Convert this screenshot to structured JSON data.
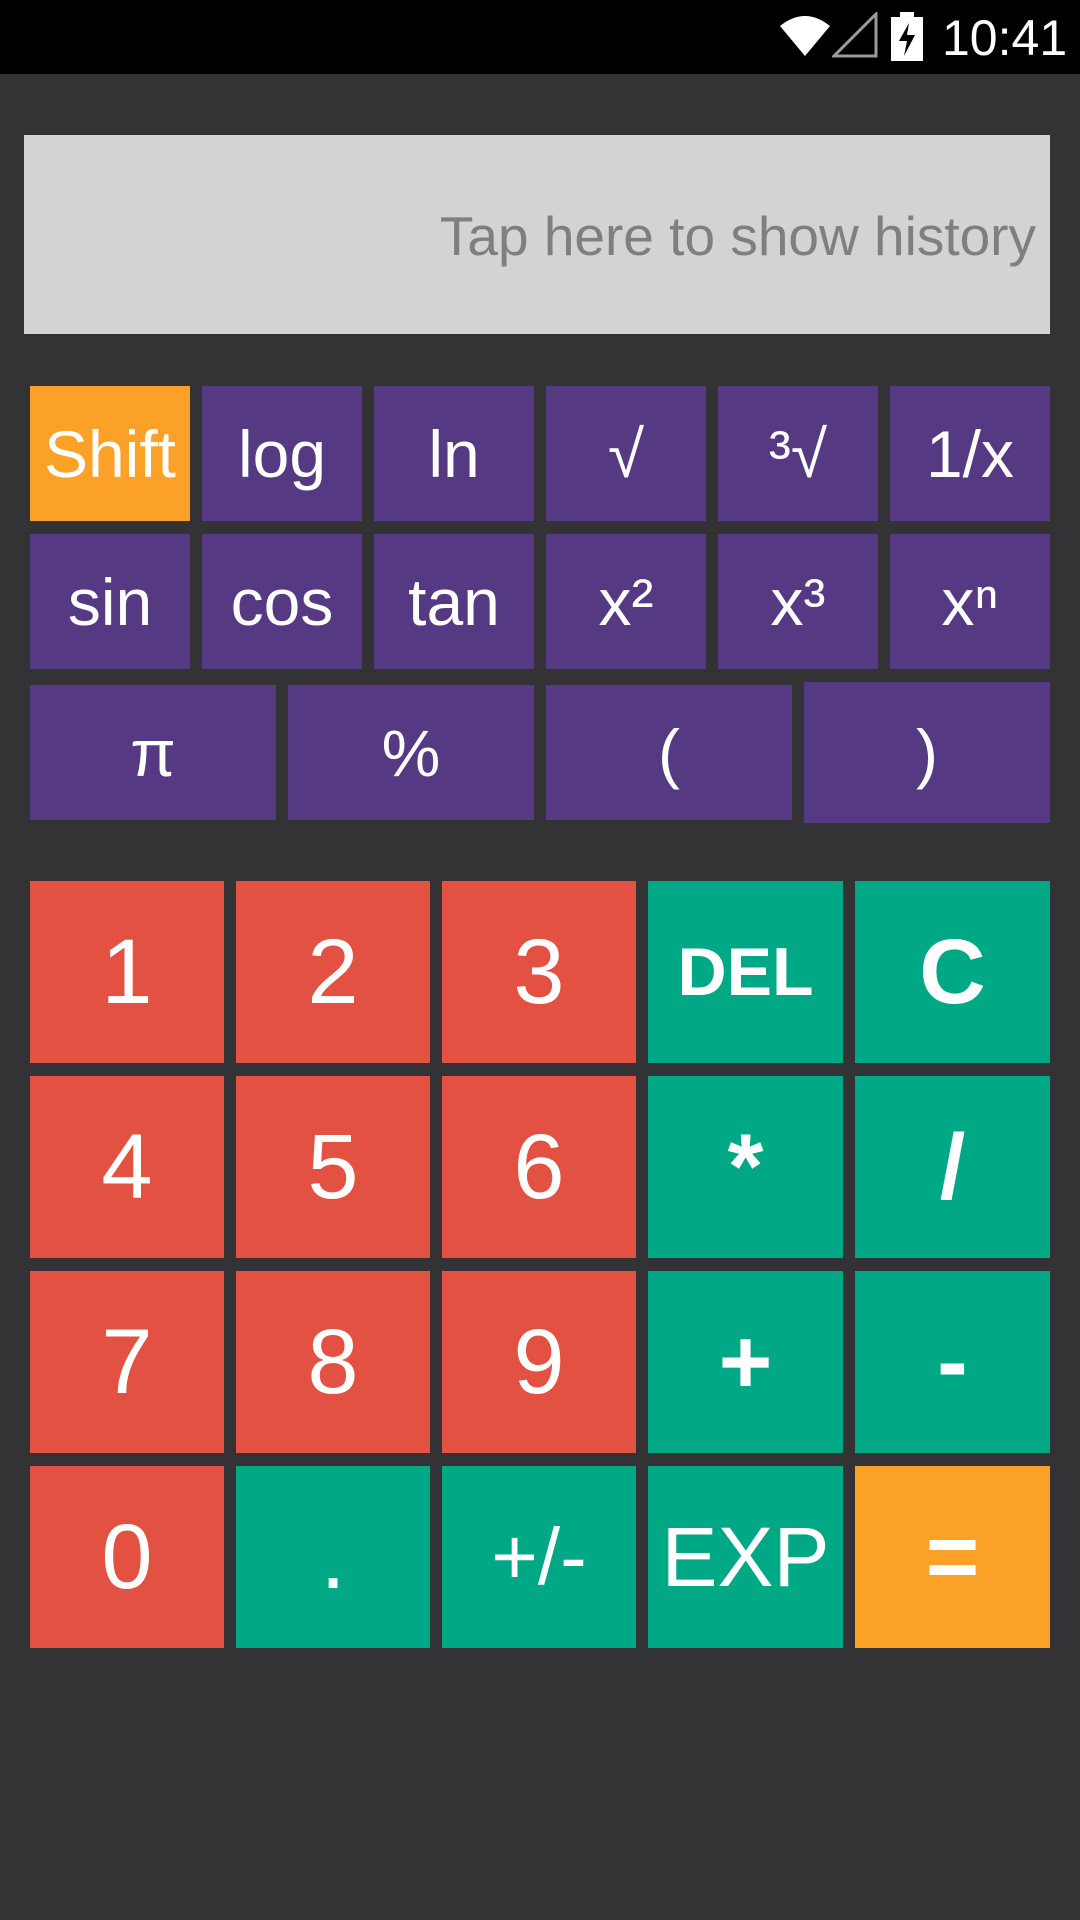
{
  "status_bar": {
    "time": "10:41",
    "icons": [
      "wifi-icon",
      "signal-icon",
      "battery-charging-icon"
    ]
  },
  "display": {
    "hint": "Tap here to show history"
  },
  "scientific_keys": {
    "row1": [
      "Shift",
      "log",
      "ln",
      "√",
      "³√",
      "1/x"
    ],
    "row2": [
      "sin",
      "cos",
      "tan",
      "x²",
      "x³",
      "xⁿ"
    ],
    "row3": [
      "π",
      "%",
      "(",
      ")"
    ]
  },
  "keypad": {
    "row1": [
      "1",
      "2",
      "3",
      "DEL",
      "C"
    ],
    "row2": [
      "4",
      "5",
      "6",
      "*",
      "/"
    ],
    "row3": [
      "7",
      "8",
      "9",
      "+",
      "-"
    ],
    "row4": [
      "0",
      ".",
      "+/-",
      "EXP",
      "="
    ]
  },
  "colors": {
    "background": "#333335",
    "display": "#d1d3d4",
    "purple": "#553982",
    "orange": "#fba127",
    "red": "#e25142",
    "green": "#00a885"
  }
}
